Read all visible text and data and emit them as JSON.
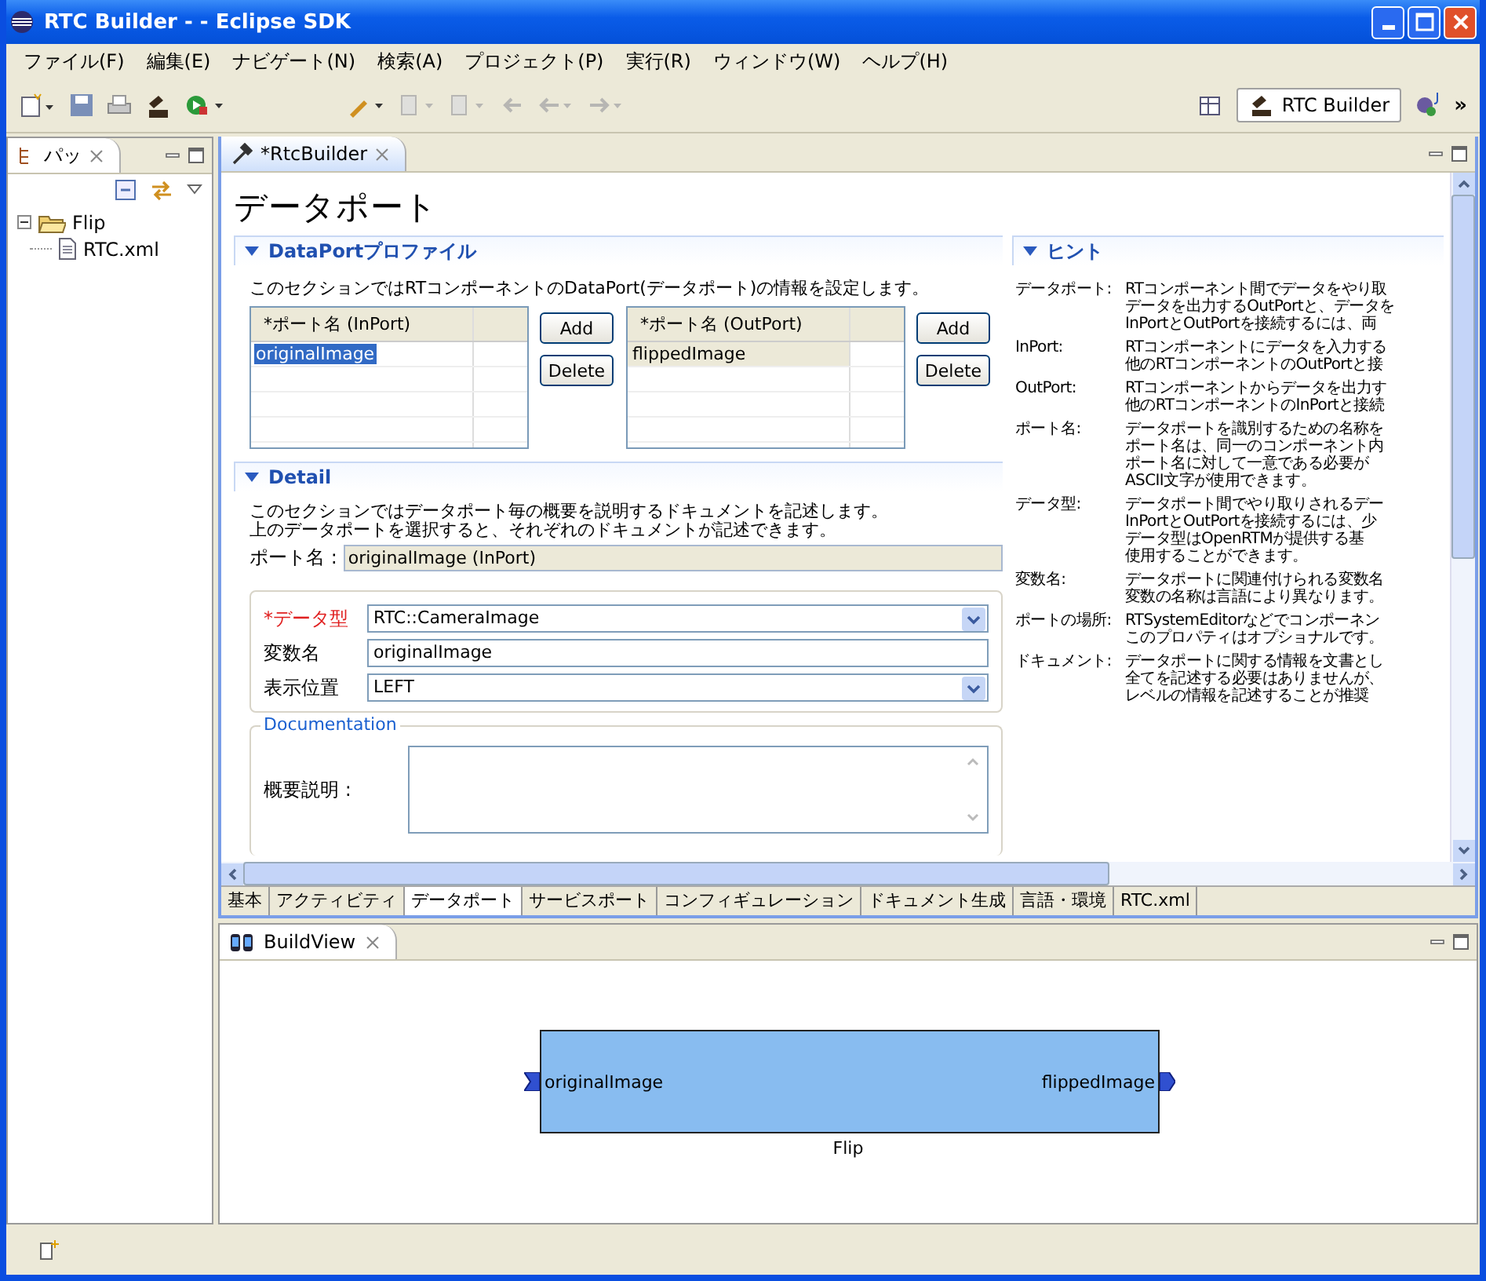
{
  "window": {
    "title": "RTC Builder - - Eclipse SDK"
  },
  "menu": [
    "ファイル(F)",
    "編集(E)",
    "ナビゲート(N)",
    "検索(A)",
    "プロジェクト(P)",
    "実行(R)",
    "ウィンドウ(W)",
    "ヘルプ(H)"
  ],
  "perspective": {
    "label": "RTC Builder",
    "more": "»"
  },
  "left_view": {
    "tab": "パッ",
    "tree": [
      {
        "label": "Flip",
        "kind": "folder",
        "expanded": true,
        "children": [
          {
            "label": "RTC.xml",
            "kind": "file"
          }
        ]
      }
    ]
  },
  "editor": {
    "tab": "*RtcBuilder",
    "page_title": "データポート",
    "profile": {
      "title": "DataPortプロファイル",
      "description": "このセクションではRTコンポーネントのDataPort(データポート)の情報を設定します。",
      "tables": [
        {
          "header": "*ポート名 (InPort)",
          "rows": [
            {
              "name": "originalImage",
              "selected": true
            }
          ],
          "buttons": [
            "Add",
            "Delete"
          ]
        },
        {
          "header": "*ポート名 (OutPort)",
          "rows": [
            {
              "name": "flippedImage",
              "selected": false
            }
          ],
          "buttons": [
            "Add",
            "Delete"
          ]
        }
      ]
    },
    "detail": {
      "title": "Detail",
      "description": [
        "このセクションではデータポート毎の概要を説明するドキュメントを記述します。",
        "上のデータポートを選択すると、それぞれのドキュメントが記述できます。"
      ],
      "port_name_label": "ポート名 :",
      "port_name": "originalImage (InPort)",
      "fields": [
        {
          "label": "*データ型",
          "kind": "dropdown",
          "required": true,
          "value": "RTC::CameraImage"
        },
        {
          "label": "変数名",
          "kind": "text",
          "required": false,
          "value": "originalImage"
        },
        {
          "label": "表示位置",
          "kind": "dropdown",
          "required": false,
          "value": "LEFT"
        }
      ],
      "documentation": {
        "title": "Documentation",
        "label": "概要説明 :"
      }
    },
    "hint": {
      "title": "ヒント",
      "items": [
        {
          "label": "データポート:",
          "lines": [
            "RTコンポーネント間でデータをやり取",
            "データを出力するOutPortと、データを",
            "InPortとOutPortを接続するには、両"
          ]
        },
        {
          "label": "InPort:",
          "lines": [
            "RTコンポーネントにデータを入力する",
            "他のRTコンポーネントのOutPortと接"
          ]
        },
        {
          "label": "OutPort:",
          "lines": [
            "RTコンポーネントからデータを出力す",
            "他のRTコンポーネントのInPortと接続"
          ]
        },
        {
          "label": "ポート名:",
          "lines": [
            "データポートを識別するための名称を",
            "ポート名は、同一のコンポーネント内",
            "ポート名に対して一意である必要が",
            "ASCII文字が使用できます。"
          ]
        },
        {
          "label": "データ型:",
          "lines": [
            "データポート間でやり取りされるデー",
            "InPortとOutPortを接続するには、少",
            "データ型はOpenRTMが提供する基",
            "使用することができます。"
          ]
        },
        {
          "label": "変数名:",
          "lines": [
            "データポートに関連付けられる変数名",
            "変数の名称は言語により異なります。"
          ]
        },
        {
          "label": "ポートの場所:",
          "lines": [
            "RTSystemEditorなどでコンポーネン",
            "このプロパティはオプショナルです。"
          ]
        },
        {
          "label": "ドキュメント:",
          "lines": [
            "データポートに関する情報を文書とし",
            "全てを記述する必要はありませんが、",
            "レベルの情報を記述することが推奨"
          ]
        }
      ]
    },
    "bottom_tabs": [
      {
        "label": "基本",
        "selected": false
      },
      {
        "label": "アクティビティ",
        "selected": false
      },
      {
        "label": "データポート",
        "selected": true
      },
      {
        "label": "サービスポート",
        "selected": false
      },
      {
        "label": "コンフィギュレーション",
        "selected": false
      },
      {
        "label": "ドキュメント生成",
        "selected": false
      },
      {
        "label": "言語・環境",
        "selected": false
      },
      {
        "label": "RTC.xml",
        "selected": false
      }
    ]
  },
  "build_view": {
    "tab": "BuildView",
    "component": {
      "name": "Flip",
      "inport": "originalImage",
      "outport": "flippedImage"
    }
  }
}
